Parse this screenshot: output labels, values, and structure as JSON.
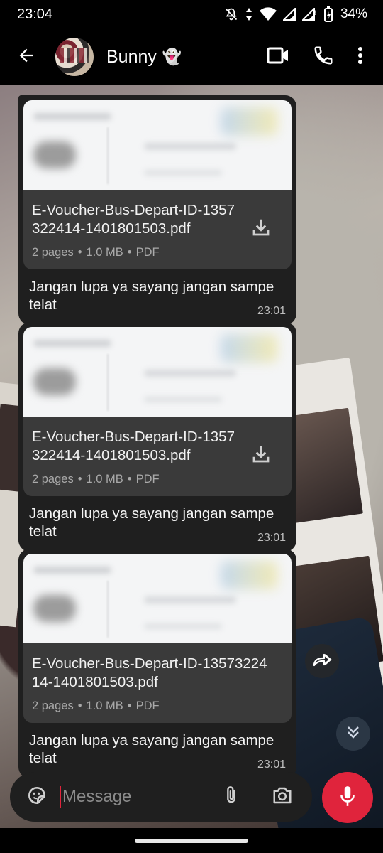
{
  "status_bar": {
    "time": "23:04",
    "battery": "34%",
    "icons": [
      "mute-icon",
      "data-arrows-icon",
      "wifi-icon",
      "signal-icon",
      "signal-icon",
      "battery-icon"
    ]
  },
  "header": {
    "contact_name": "Bunny",
    "contact_emoji": "👻",
    "actions": [
      "video-call-icon",
      "phone-icon",
      "more-vert-icon"
    ]
  },
  "messages": [
    {
      "file_name": "E-Voucher-Bus-Depart-ID-1357322414-1401801503.pdf",
      "file_pages": "2 pages",
      "file_size": "1.0 MB",
      "file_type": "PDF",
      "caption": "Jangan lupa ya sayang jangan sampe telat",
      "time": "23:01"
    },
    {
      "file_name": "E-Voucher-Bus-Depart-ID-1357322414-1401801503.pdf",
      "file_pages": "2 pages",
      "file_size": "1.0 MB",
      "file_type": "PDF",
      "caption": "Jangan lupa ya sayang jangan sampe telat",
      "time": "23:01"
    },
    {
      "file_name": "E-Voucher-Bus-Depart-ID-1357322414-1401801503.pdf",
      "file_pages": "2 pages",
      "file_size": "1.0 MB",
      "file_type": "PDF",
      "caption": "Jangan lupa ya sayang jangan sampe telat",
      "time": "23:01"
    }
  ],
  "meta_separator": "•",
  "composer": {
    "placeholder": "Message"
  },
  "colors": {
    "accent": "#e0243c",
    "bubble": "#1f1f1f",
    "file_box": "#3a3a3a"
  }
}
